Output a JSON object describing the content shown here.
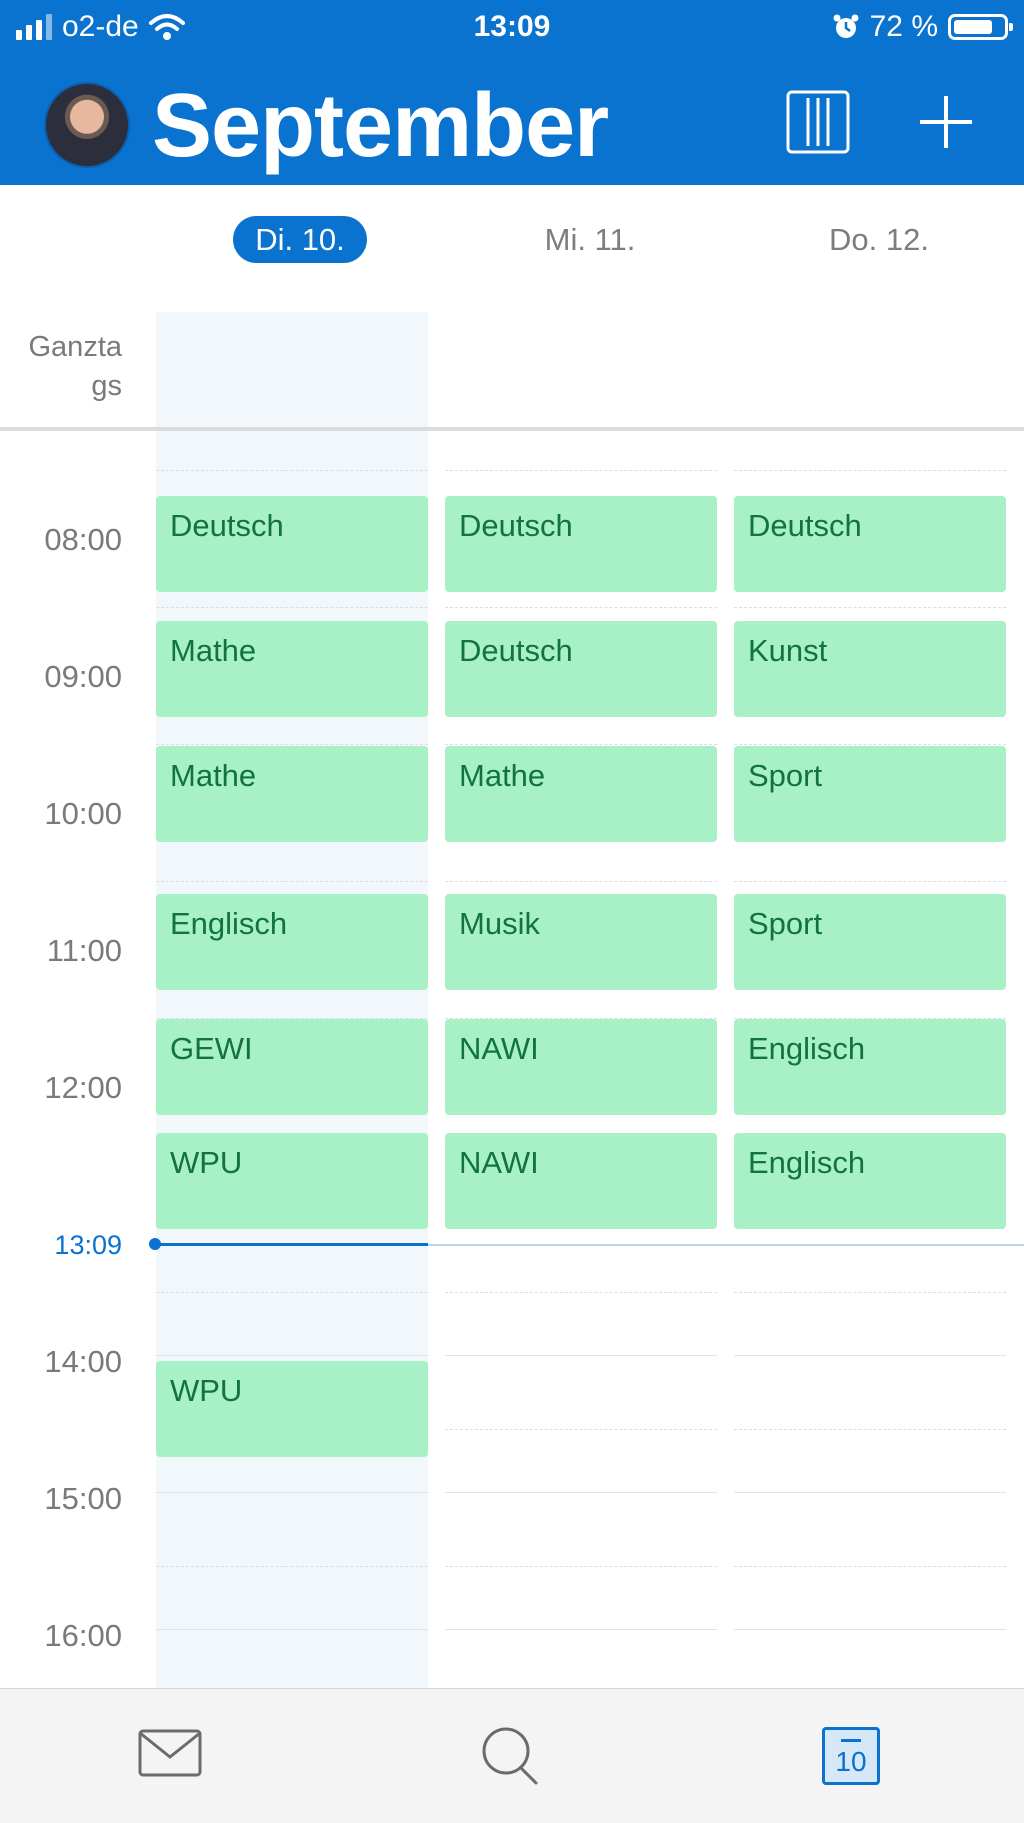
{
  "status_bar": {
    "carrier": "o2-de",
    "time": "13:09",
    "battery": "72 %",
    "battery_level": 0.72
  },
  "header": {
    "month": "September",
    "icons": [
      "avatar",
      "week-view-icon",
      "add-icon"
    ]
  },
  "days": [
    {
      "label": "Di. 10.",
      "today": true
    },
    {
      "label": "Mi. 11.",
      "today": false
    },
    {
      "label": "Do. 12.",
      "today": false
    }
  ],
  "all_day_label": "Ganzta\ngs",
  "hours": [
    "08:00",
    "09:00",
    "10:00",
    "11:00",
    "12:00",
    "14:00",
    "15:00",
    "16:00"
  ],
  "now_label": "13:09",
  "events": {
    "day1": [
      "Deutsch",
      "Mathe",
      "Mathe",
      "Englisch",
      "GEWI",
      "WPU",
      "WPU"
    ],
    "day2": [
      "Deutsch",
      "Deutsch",
      "Mathe",
      "Musik",
      "NAWI",
      "NAWI"
    ],
    "day3": [
      "Deutsch",
      "Kunst",
      "Sport",
      "Sport",
      "Englisch",
      "Englisch"
    ]
  },
  "colors": {
    "accent": "#0A72CF",
    "event_bg": "#A8F1C6",
    "event_text": "#12733d"
  },
  "tabbar": {
    "icons": [
      "mail-icon",
      "search-icon",
      "calendar-icon"
    ],
    "calendar_day": "10"
  }
}
